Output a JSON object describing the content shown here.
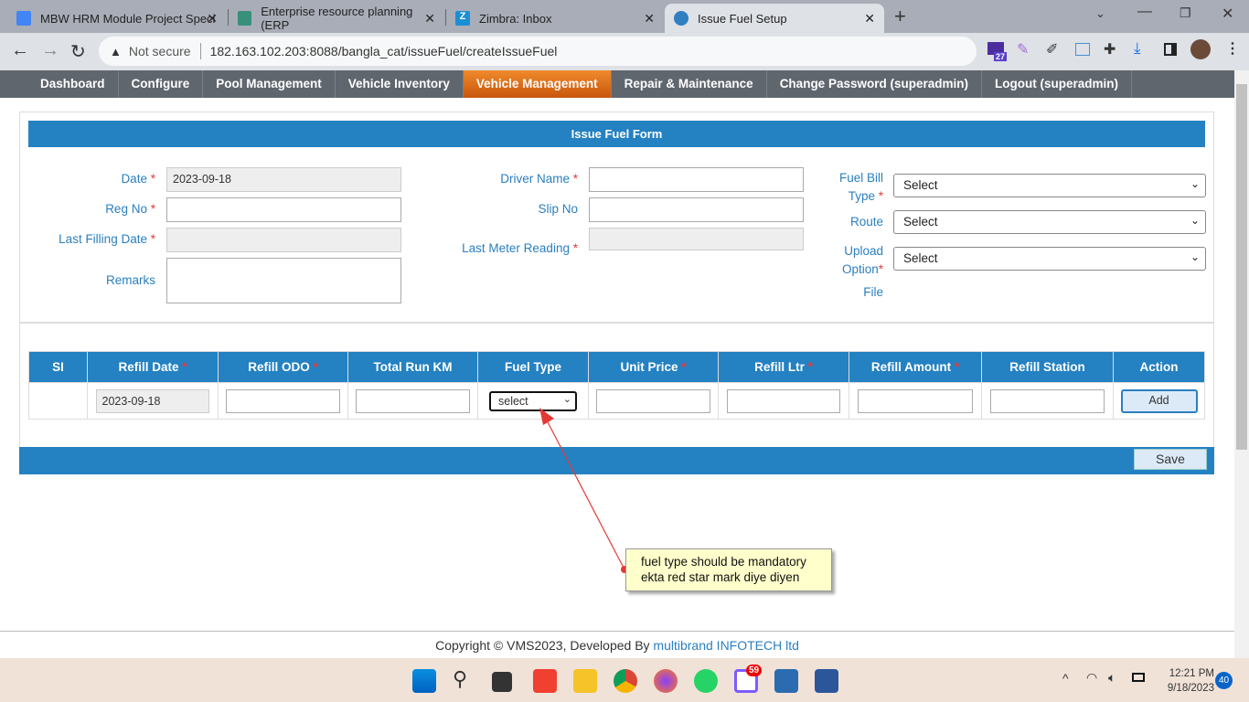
{
  "browser": {
    "tabs": [
      {
        "title": "MBW HRM Module Project Speci"
      },
      {
        "title": "Enterprise resource planning (ERP"
      },
      {
        "title": "Zimbra: Inbox"
      },
      {
        "title": "Issue Fuel Setup"
      }
    ],
    "security": "Not secure",
    "url": "182.163.102.203:8088/bangla_cat/issueFuel/createIssueFuel",
    "ext_badge": "27"
  },
  "nav": [
    "Dashboard",
    "Configure",
    "Pool Management",
    "Vehicle Inventory",
    "Vehicle Management",
    "Repair & Maintenance",
    "Change Password (superadmin)",
    "Logout (superadmin)"
  ],
  "form": {
    "title": "Issue Fuel Form",
    "date_label": "Date",
    "date_value": "2023-09-18",
    "reg_label": "Reg No",
    "last_fill_label": "Last Filling Date",
    "remarks_label": "Remarks",
    "driver_label": "Driver Name",
    "slip_label": "Slip No",
    "meter_label": "Last Meter Reading",
    "bill_label_1": "Fuel Bill",
    "bill_label_2": "Type",
    "route_label": "Route",
    "upload_label_1": "Upload",
    "upload_label_2": "Option",
    "file_label": "File",
    "select": "Select",
    "star": "*"
  },
  "table": {
    "headers": [
      "SI",
      "Refill Date",
      "Refill ODO",
      "Total Run KM",
      "Fuel Type",
      "Unit Price",
      "Refill Ltr",
      "Refill Amount",
      "Refill Station",
      "Action"
    ],
    "refill_date": "2023-09-18",
    "fuel_type": "select",
    "add": "Add"
  },
  "save": "Save",
  "annotation": {
    "line1": "fuel type should be mandatory",
    "line2": "ekta red star mark diye diyen"
  },
  "footer": {
    "text": "Copyright © VMS2023, Developed By ",
    "link": "multibrand INFOTECH ltd"
  },
  "taskbar": {
    "badge": "59",
    "time": "12:21 PM",
    "date": "9/18/2023",
    "notif": "40"
  }
}
